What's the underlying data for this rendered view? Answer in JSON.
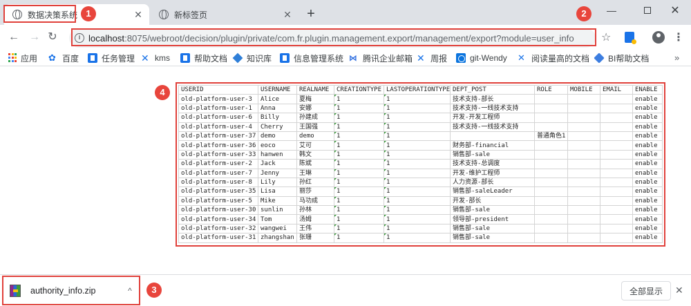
{
  "tabs": [
    {
      "title": "数据决策系统",
      "close": "✕",
      "active": true
    },
    {
      "title": "新标签页",
      "close": "✕",
      "active": false
    }
  ],
  "new_tab_label": "+",
  "window_controls": {
    "minimize": "—",
    "maximize": "",
    "close": "✕"
  },
  "toolbar": {
    "back": "←",
    "forward": "→",
    "reload": "↻",
    "star": "☆",
    "menu": "⋮"
  },
  "address": {
    "host": "localhost",
    "rest": ":8075/webroot/decision/plugin/private/com.fr.plugin.management.export/management/export?module=user_info"
  },
  "bookmarks": [
    {
      "label": "应用",
      "icon": "apps-icon"
    },
    {
      "label": "百度",
      "icon": "baidu-paw-icon"
    },
    {
      "label": "任务管理",
      "icon": "doc-icon"
    },
    {
      "label": "kms",
      "icon": "x-icon"
    },
    {
      "label": "帮助文档",
      "icon": "doc-icon"
    },
    {
      "label": "知识库",
      "icon": "cube-icon"
    },
    {
      "label": "信息管理系统",
      "icon": "doc-icon"
    },
    {
      "label": "腾讯企业邮箱",
      "icon": "mail-icon"
    },
    {
      "label": "周报",
      "icon": "x-icon"
    },
    {
      "label": "git-Wendy",
      "icon": "git-icon"
    },
    {
      "label": "阅读量高的文档",
      "icon": "x-icon"
    },
    {
      "label": "BI帮助文档",
      "icon": "bi-icon"
    }
  ],
  "bookmarks_more": "»",
  "table": {
    "headers": [
      "USERID",
      "USERNAME",
      "REALNAME",
      "CREATIONTYPE",
      "LASTOPERATIONTYPE",
      "DEPT_POST",
      "ROLE",
      "MOBILE",
      "EMAIL",
      "ENABLE"
    ],
    "rows": [
      [
        "old-platform-user-3",
        "Alice",
        "夏梅",
        "1",
        "1",
        "技术支持-部长",
        "",
        "",
        "",
        "enable"
      ],
      [
        "old-platform-user-1",
        "Anna",
        "安娜",
        "1",
        "1",
        "技术支持-一线技术支持",
        "",
        "",
        "",
        "enable"
      ],
      [
        "old-platform-user-6",
        "Billy",
        "孙建成",
        "1",
        "1",
        "开发-开发工程师",
        "",
        "",
        "",
        "enable"
      ],
      [
        "old-platform-user-4",
        "Cherry",
        "王国强",
        "1",
        "1",
        "技术支持-一线技术支持",
        "",
        "",
        "",
        "enable"
      ],
      [
        "old-platform-user-37",
        "demo",
        "demo",
        "1",
        "1",
        "",
        "普通角色1",
        "",
        "",
        "enable"
      ],
      [
        "old-platform-user-36",
        "eoco",
        "艾可",
        "1",
        "1",
        "财务部-financial",
        "",
        "",
        "",
        "enable"
      ],
      [
        "old-platform-user-33",
        "hanwen",
        "韩文",
        "1",
        "1",
        "销售部-sale",
        "",
        "",
        "",
        "enable"
      ],
      [
        "old-platform-user-2",
        "Jack",
        "陈斌",
        "1",
        "1",
        "技术支持-总调度",
        "",
        "",
        "",
        "enable"
      ],
      [
        "old-platform-user-7",
        "Jenny",
        "王琳",
        "1",
        "1",
        "开发-维护工程师",
        "",
        "",
        "",
        "enable"
      ],
      [
        "old-platform-user-8",
        "Lily",
        "孙红",
        "1",
        "1",
        "人力资源-部长",
        "",
        "",
        "",
        "enable"
      ],
      [
        "old-platform-user-35",
        "Lisa",
        "丽莎",
        "1",
        "1",
        "销售部-saleLeader",
        "",
        "",
        "",
        "enable"
      ],
      [
        "old-platform-user-5",
        "Mike",
        "马功成",
        "1",
        "1",
        "开发-部长",
        "",
        "",
        "",
        "enable"
      ],
      [
        "old-platform-user-30",
        "sunlin",
        "孙林",
        "1",
        "1",
        "销售部-sale",
        "",
        "",
        "",
        "enable"
      ],
      [
        "old-platform-user-34",
        "Tom",
        "汤姆",
        "1",
        "1",
        "领导部-president",
        "",
        "",
        "",
        "enable"
      ],
      [
        "old-platform-user-32",
        "wangwei",
        "王伟",
        "1",
        "1",
        "销售部-sale",
        "",
        "",
        "",
        "enable"
      ],
      [
        "old-platform-user-31",
        "zhangshan",
        "张珊",
        "1",
        "1",
        "销售部-sale",
        "",
        "",
        "",
        "enable"
      ]
    ]
  },
  "download": {
    "file_name": "authority_info.zip",
    "chevron": "^",
    "show_all": "全部显示",
    "close": "✕"
  },
  "annotations": [
    "1",
    "2",
    "3",
    "4"
  ],
  "colors": {
    "annotation_red": "#e0403a",
    "badge_red": "#e8453c",
    "tab_strip": "#dee1e6"
  }
}
